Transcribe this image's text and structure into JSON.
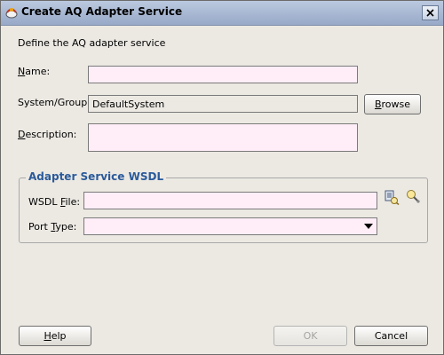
{
  "window": {
    "title": "Create AQ Adapter Service"
  },
  "intro": "Define the AQ adapter service",
  "form": {
    "name": {
      "label_pre": "",
      "label_key": "N",
      "label_post": "ame:",
      "value": "",
      "placeholder": ""
    },
    "system_group": {
      "label": "System/Group:",
      "value": "DefaultSystem"
    },
    "browse_button": {
      "label_key": "B",
      "label_post": "rowse"
    },
    "description": {
      "label_key": "D",
      "label_post": "escription:",
      "value": ""
    }
  },
  "wsdl_group": {
    "title": "Adapter Service WSDL",
    "wsdl_file": {
      "label_pre": "WSDL ",
      "label_key": "F",
      "label_post": "ile:",
      "value": ""
    },
    "port_type": {
      "label_pre": "Port ",
      "label_key": "T",
      "label_post": "ype:",
      "selected": ""
    },
    "icons": [
      "browse-wsdl-icon",
      "wsdl-lookup-icon"
    ]
  },
  "buttons": {
    "help": {
      "label_key": "H",
      "label_post": "elp"
    },
    "ok": {
      "label": "OK",
      "enabled": false
    },
    "cancel": {
      "label": "Cancel"
    }
  },
  "colors": {
    "group_title": "#2a5a9b",
    "field_bg": "#ffeef8",
    "dialog_bg": "#ece9e3"
  }
}
